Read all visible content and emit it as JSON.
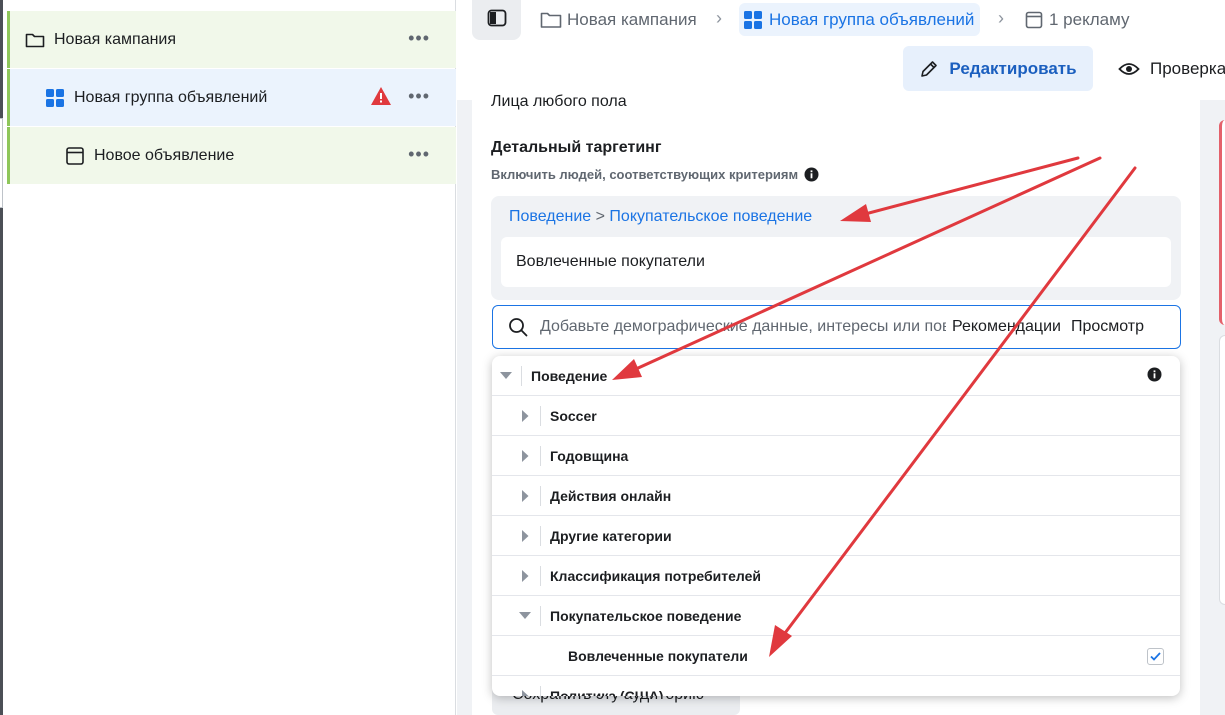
{
  "tree": {
    "campaign": {
      "label": "Новая кампания"
    },
    "adset": {
      "label": "Новая группа объявлений"
    },
    "ad": {
      "label": "Новое объявление"
    },
    "more": "•••"
  },
  "breadcrumb": {
    "campaign": "Новая кампания",
    "adset": "Новая группа объявлений",
    "ad": "1 рекламу",
    "separator": "›"
  },
  "toolbar": {
    "edit_label": "Редактировать",
    "preview_label": "Проверка"
  },
  "audience": {
    "gender_text": "Лица любого пола"
  },
  "detailed_targeting": {
    "title": "Детальный таргетинг",
    "subtitle": "Включить людей, соответствующих критериям",
    "selected_path_parent": "Поведение",
    "selected_path_sep": ">",
    "selected_path_child": "Покупательское поведение",
    "selected_item": "Вовлеченные покупатели",
    "search_placeholder": "Добавьте демографические данные, интересы или поведение",
    "search_suggestions": "Рекомендации",
    "search_browse": "Просмотр",
    "save_audience": "Сохранить эту аудиторию"
  },
  "dropdown": {
    "root": "Поведение",
    "items": [
      "Soccer",
      "Годовщина",
      "Действия онлайн",
      "Другие категории",
      "Классификация потребителей",
      "Покупательское поведение"
    ],
    "sub_item": "Вовлеченные покупатели",
    "partial_item": "Политика (США)"
  },
  "colors": {
    "accent": "#1b74e4",
    "annotation_red": "#e0393e",
    "warning": "#e0393e"
  }
}
